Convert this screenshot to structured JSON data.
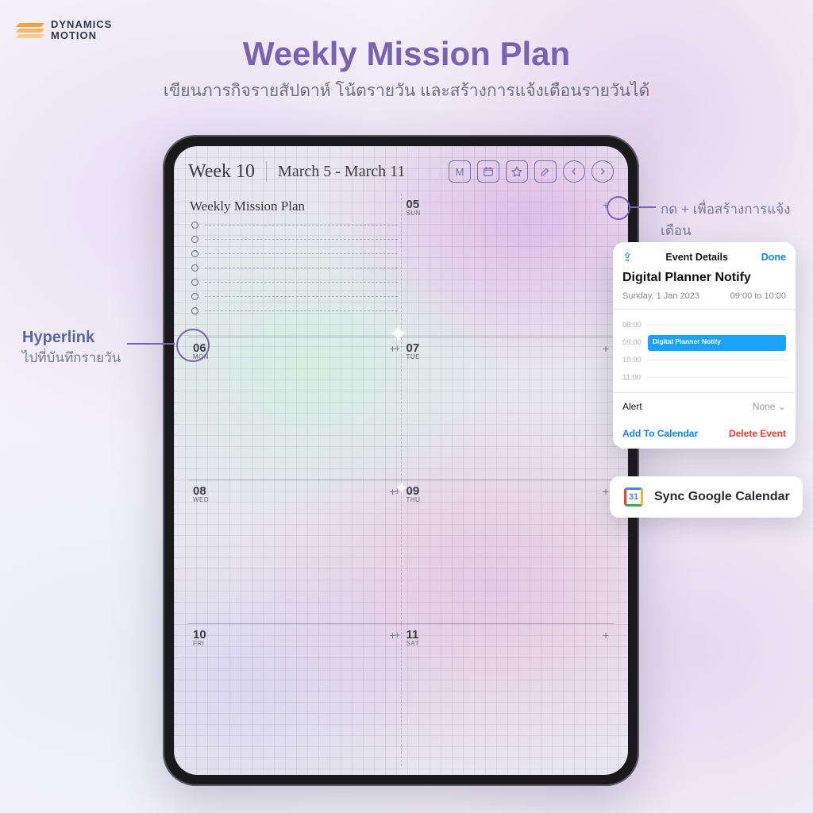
{
  "brand": {
    "line1": "DYNAMICS",
    "line2": "MOTION"
  },
  "header": {
    "title": "Weekly Mission Plan",
    "subtitle": "เขียนภารกิจรายสัปดาห์ โน้ตรายวัน และสร้างการแจ้งเตือนรายวันได้"
  },
  "toolbar": {
    "week": "Week 10",
    "range": "March 5  - March 11",
    "icons": {
      "month": "M",
      "calendar": "calendar-icon",
      "star": "star-icon",
      "edit": "edit-icon",
      "prev": "chevron-left-icon",
      "next": "chevron-right-icon"
    }
  },
  "planner": {
    "mission_title": "Weekly Mission Plan",
    "days": [
      {
        "num": "05",
        "dow": "SUN"
      },
      {
        "num": "06",
        "dow": "MON"
      },
      {
        "num": "07",
        "dow": "TUE"
      },
      {
        "num": "08",
        "dow": "WED"
      },
      {
        "num": "09",
        "dow": "THU"
      },
      {
        "num": "10",
        "dow": "FRI"
      },
      {
        "num": "11",
        "dow": "SAT"
      }
    ]
  },
  "callouts": {
    "plus": {
      "text": "กด + เพื่อสร้างการแจ้งเตือน"
    },
    "hyperlink": {
      "title": "Hyperlink",
      "sub": "ไปที่บันทึกรายวัน"
    }
  },
  "popup": {
    "title": "Event Details",
    "done": "Done",
    "name": "Digital Planner Notify",
    "date": "Sunday, 1 Jan 2023",
    "time": "09:00 to 10:00",
    "hours": [
      "08:00",
      "09:00",
      "10:00",
      "11:00"
    ],
    "event_label": "Digital Planner Notify",
    "alert_label": "Alert",
    "alert_value": "None",
    "add": "Add To Calendar",
    "delete": "Delete Event"
  },
  "gcal": {
    "day": "31",
    "label": "Sync Google Calendar"
  }
}
